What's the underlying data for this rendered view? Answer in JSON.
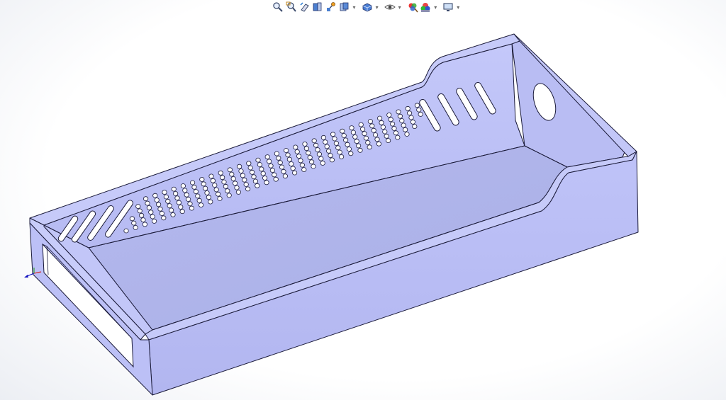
{
  "window": {
    "viewport": "graphics-area"
  },
  "toolbar": {
    "items": [
      {
        "name": "zoom-to-fit-icon",
        "has_dropdown": false
      },
      {
        "name": "zoom-to-area-icon",
        "has_dropdown": false
      },
      {
        "name": "previous-view-icon",
        "has_dropdown": false
      },
      {
        "name": "section-view-icon",
        "has_dropdown": false
      },
      {
        "name": "dynamic-annotation-icon",
        "has_dropdown": false
      },
      {
        "name": "view-orientation-icon",
        "has_dropdown": true
      },
      {
        "name": "display-style-icon",
        "has_dropdown": true
      },
      {
        "name": "hide-show-items-icon",
        "has_dropdown": true
      },
      {
        "name": "edit-appearance-icon",
        "has_dropdown": false
      },
      {
        "name": "apply-scene-icon",
        "has_dropdown": true
      },
      {
        "name": "view-settings-icon",
        "has_dropdown": true
      }
    ],
    "dropdown_glyph": "▾"
  },
  "model": {
    "part": "vented-tray",
    "body_color": "#bcc0f5",
    "shade_color": "#a9ade0",
    "edge_color": "#1b1b3a",
    "triad_colors": {
      "x": "#d03030",
      "y": "#30a030",
      "z": "#1010c0"
    }
  }
}
